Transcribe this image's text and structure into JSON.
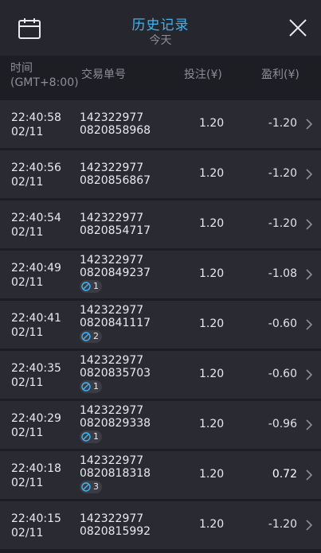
{
  "header": {
    "title": "历史记录",
    "subtitle": "今天",
    "icons": {
      "calendar": "calendar-icon",
      "close": "close-icon"
    },
    "title_color": "#3fb4f2"
  },
  "columns": {
    "time_line1": "时间",
    "time_line2": "(GMT+8:00)",
    "order": "交易单号",
    "bet": "投注(¥)",
    "pnl": "盈利(¥)"
  },
  "rows": [
    {
      "time": "22:40:58",
      "date": "02/11",
      "order1": "142322977",
      "order2": "0820858968",
      "badge": "",
      "bet": "1.20",
      "pnl": "-1.20"
    },
    {
      "time": "22:40:56",
      "date": "02/11",
      "order1": "142322977",
      "order2": "0820856867",
      "badge": "",
      "bet": "1.20",
      "pnl": "-1.20"
    },
    {
      "time": "22:40:54",
      "date": "02/11",
      "order1": "142322977",
      "order2": "0820854717",
      "badge": "",
      "bet": "1.20",
      "pnl": "-1.20"
    },
    {
      "time": "22:40:49",
      "date": "02/11",
      "order1": "142322977",
      "order2": "0820849237",
      "badge": "1",
      "bet": "1.20",
      "pnl": "-1.08"
    },
    {
      "time": "22:40:41",
      "date": "02/11",
      "order1": "142322977",
      "order2": "0820841117",
      "badge": "2",
      "bet": "1.20",
      "pnl": "-0.60"
    },
    {
      "time": "22:40:35",
      "date": "02/11",
      "order1": "142322977",
      "order2": "0820835703",
      "badge": "1",
      "bet": "1.20",
      "pnl": "-0.60"
    },
    {
      "time": "22:40:29",
      "date": "02/11",
      "order1": "142322977",
      "order2": "0820829338",
      "badge": "1",
      "bet": "1.20",
      "pnl": "-0.96"
    },
    {
      "time": "22:40:18",
      "date": "02/11",
      "order1": "142322977",
      "order2": "0820818318",
      "badge": "3",
      "bet": "1.20",
      "pnl": "0.72"
    },
    {
      "time": "22:40:15",
      "date": "02/11",
      "order1": "142322977",
      "order2": "0820815992",
      "badge": "",
      "bet": "1.20",
      "pnl": "-1.20"
    }
  ]
}
